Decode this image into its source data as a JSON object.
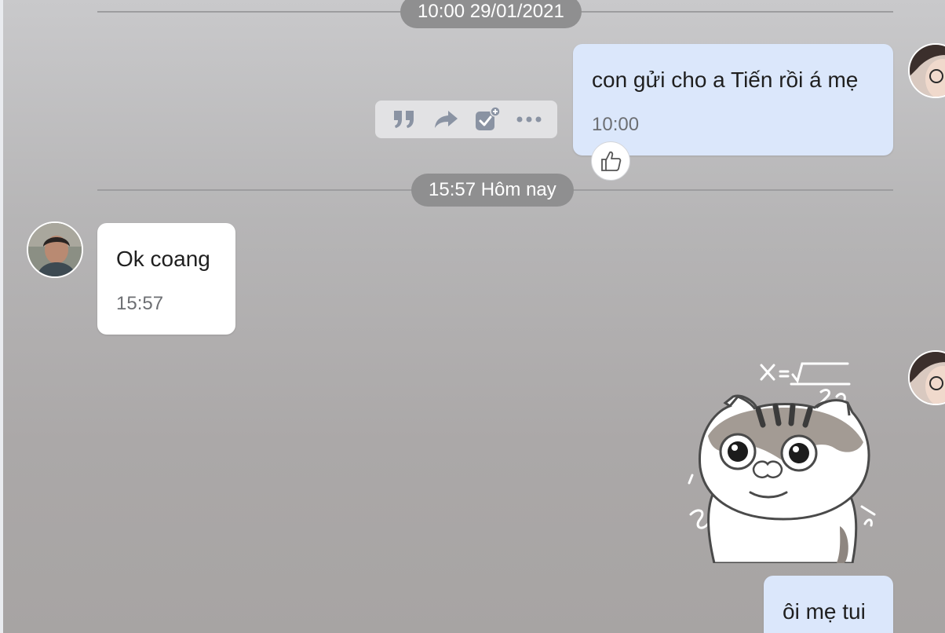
{
  "conversation": {
    "dividers": [
      {
        "label": "10:00 29/01/2021"
      },
      {
        "label": "15:57 Hôm nay"
      }
    ],
    "messages": [
      {
        "sender": "me",
        "text": "con gửi cho a Tiến rồi á mẹ",
        "time": "10:00"
      },
      {
        "sender": "other",
        "text": "Ok coang",
        "time": "15:57"
      },
      {
        "sender": "me",
        "type": "sticker",
        "sticker_icon": "cat-sticker-math"
      },
      {
        "sender": "me",
        "text": "ôi mẹ tui"
      }
    ]
  },
  "message_actions": {
    "icons": [
      "quote-icon",
      "forward-icon",
      "select-message-icon",
      "more-icon"
    ]
  },
  "reaction": {
    "icon": "thumbs-up-icon"
  },
  "colors": {
    "my_bubble": "#dbe7fb",
    "other_bubble": "#ffffff",
    "divider_pill": "#8f8f90",
    "toolbar_icon": "#8a93a3"
  }
}
